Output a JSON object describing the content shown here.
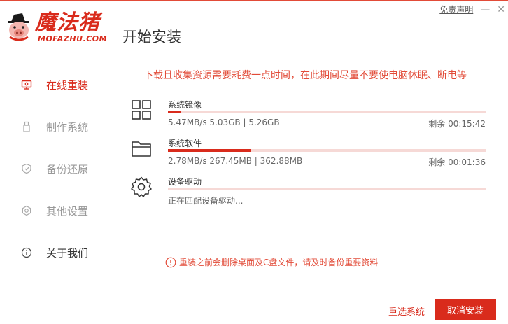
{
  "header": {
    "logo_text": "魔法猪",
    "logo_sub": "MOFAZHU.COM",
    "title": "开始安装",
    "disclaimer": "免责声明",
    "minimize": "—",
    "close": "✕"
  },
  "sidebar": {
    "items": [
      {
        "label": "在线重装",
        "icon": "monitor-icon",
        "active": true
      },
      {
        "label": "制作系统",
        "icon": "usb-icon",
        "active": false
      },
      {
        "label": "备份还原",
        "icon": "backup-icon",
        "active": false
      },
      {
        "label": "其他设置",
        "icon": "gear-icon",
        "active": false
      },
      {
        "label": "关于我们",
        "icon": "info-icon",
        "active": false
      }
    ]
  },
  "main": {
    "notice": "下载且收集资源需要耗费一点时间，在此期间尽量不要使电脑休眠、断电等",
    "tasks": [
      {
        "name": "系统镜像",
        "stats": "5.47MB/s 5.03GB | 5.26GB",
        "remaining": "剩余 00:15:42",
        "progress": 0.04,
        "icon": "windows-icon"
      },
      {
        "name": "系统软件",
        "stats": "2.78MB/s 267.45MB | 362.88MB",
        "remaining": "剩余 00:01:36",
        "progress": 0.26,
        "icon": "folder-icon"
      },
      {
        "name": "设备驱动",
        "stats": "正在匹配设备驱动...",
        "remaining": "",
        "progress": 0.0,
        "icon": "settings-icon"
      }
    ],
    "warning": "重装之前会删除桌面及C盘文件，请及时备份重要资料"
  },
  "footer": {
    "reselect_label": "重选系统",
    "cancel_label": "取消安装"
  },
  "colors": {
    "accent": "#d92b1c",
    "track": "#f6d9d6"
  }
}
